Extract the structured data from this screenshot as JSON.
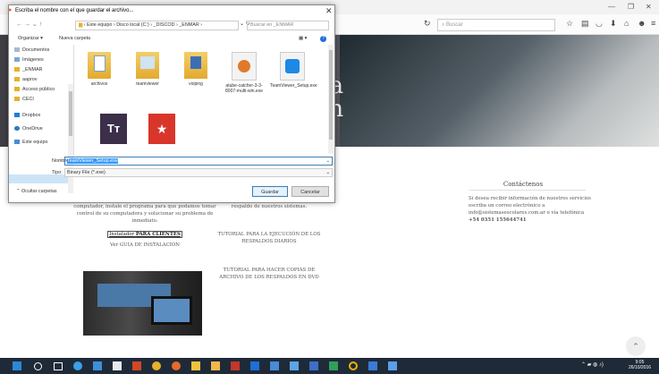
{
  "dialog": {
    "title": "Escriba el nombre con el que guardar el archivo...",
    "address_path": "›  Este equipo  ›  Disco local (C:)  ›  _DISCOD  ›  _ENMAR  ›",
    "search_placeholder": "Buscar en _ENMAR",
    "organize": "Organizar ▾",
    "new_folder": "Nueva carpeta",
    "nav_items": [
      "Documentos",
      "Imágenes",
      "_ENMAR",
      "aaprov",
      "Acceso público",
      "CECI",
      "Dropbox",
      "OneDrive",
      "Este equipo"
    ],
    "files": [
      {
        "name": "archivos",
        "icon": "folder-doc-icon"
      },
      {
        "name": "teamviewer",
        "icon": "folder-icon"
      },
      {
        "name": "voiping",
        "icon": "folder-icon"
      },
      {
        "name": "atube-catcher-3-3-8007-multi-win.exe",
        "icon": "installer-icon"
      },
      {
        "name": "TeamViewer_Setup.exe",
        "icon": "teamviewer-icon"
      },
      {
        "name": "",
        "icon": "typora-icon"
      },
      {
        "name": "",
        "icon": "wunderlist-icon"
      }
    ],
    "filename_label": "Nombre:",
    "filename_value": "TeamViewer_Setup.exe",
    "filetype_label": "Tipo:",
    "filetype_value": "Binary File (*.exe)",
    "hide_folders": "Ocultar carpetas",
    "save": "Guardar",
    "cancel": "Cancelar"
  },
  "browser": {
    "search_placeholder": "Buscar"
  },
  "page": {
    "hero_text_1": "da",
    "hero_text_2": "en",
    "left_p1": "computador, instale el programa para que podamos tomar control de su computadora y solucionar su problema de inmediato.",
    "installer_prefix": "Instalador",
    "installer_bold": "PARA CLIENTES",
    "install_guide": "Ver GUÍA DE INSTALACIÓN",
    "mid_p1": "respaldo de nuestros sistemas.",
    "tutorial_1": "TUTORIAL PARA LA EJECUCIÓN DE LOS RESPALDOS DIARIOS",
    "tutorial_2": "TUTORIAL PARA HACER COPIAS DE ARCHIVO DE LOS RESPALDOS EN DVD",
    "contact_title": "Contáctenos",
    "contact_body": "Si desea recibir información de nuestros servicios escriba un correo electrónico a info@sistemasescolares.com.ar o vía telefónica",
    "contact_phone": "+54 0351 155644741"
  },
  "taskbar": {
    "time": "9:05",
    "date": "26/10/2016"
  }
}
